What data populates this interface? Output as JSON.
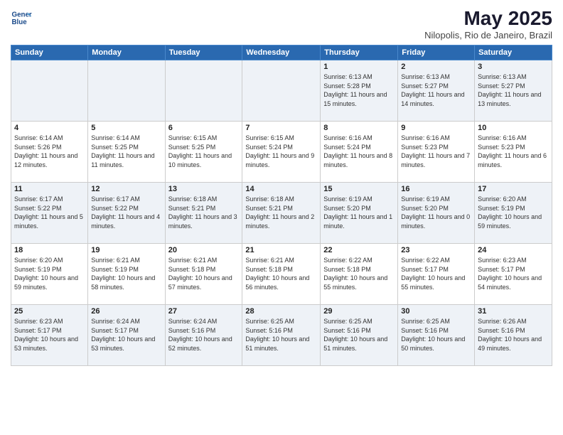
{
  "header": {
    "logo_line1": "General",
    "logo_line2": "Blue",
    "title": "May 2025",
    "subtitle": "Nilopolis, Rio de Janeiro, Brazil"
  },
  "weekdays": [
    "Sunday",
    "Monday",
    "Tuesday",
    "Wednesday",
    "Thursday",
    "Friday",
    "Saturday"
  ],
  "weeks": [
    [
      {
        "day": "",
        "info": ""
      },
      {
        "day": "",
        "info": ""
      },
      {
        "day": "",
        "info": ""
      },
      {
        "day": "",
        "info": ""
      },
      {
        "day": "1",
        "info": "Sunrise: 6:13 AM\nSunset: 5:28 PM\nDaylight: 11 hours\nand 15 minutes."
      },
      {
        "day": "2",
        "info": "Sunrise: 6:13 AM\nSunset: 5:27 PM\nDaylight: 11 hours\nand 14 minutes."
      },
      {
        "day": "3",
        "info": "Sunrise: 6:13 AM\nSunset: 5:27 PM\nDaylight: 11 hours\nand 13 minutes."
      }
    ],
    [
      {
        "day": "4",
        "info": "Sunrise: 6:14 AM\nSunset: 5:26 PM\nDaylight: 11 hours\nand 12 minutes."
      },
      {
        "day": "5",
        "info": "Sunrise: 6:14 AM\nSunset: 5:25 PM\nDaylight: 11 hours\nand 11 minutes."
      },
      {
        "day": "6",
        "info": "Sunrise: 6:15 AM\nSunset: 5:25 PM\nDaylight: 11 hours\nand 10 minutes."
      },
      {
        "day": "7",
        "info": "Sunrise: 6:15 AM\nSunset: 5:24 PM\nDaylight: 11 hours\nand 9 minutes."
      },
      {
        "day": "8",
        "info": "Sunrise: 6:16 AM\nSunset: 5:24 PM\nDaylight: 11 hours\nand 8 minutes."
      },
      {
        "day": "9",
        "info": "Sunrise: 6:16 AM\nSunset: 5:23 PM\nDaylight: 11 hours\nand 7 minutes."
      },
      {
        "day": "10",
        "info": "Sunrise: 6:16 AM\nSunset: 5:23 PM\nDaylight: 11 hours\nand 6 minutes."
      }
    ],
    [
      {
        "day": "11",
        "info": "Sunrise: 6:17 AM\nSunset: 5:22 PM\nDaylight: 11 hours\nand 5 minutes."
      },
      {
        "day": "12",
        "info": "Sunrise: 6:17 AM\nSunset: 5:22 PM\nDaylight: 11 hours\nand 4 minutes."
      },
      {
        "day": "13",
        "info": "Sunrise: 6:18 AM\nSunset: 5:21 PM\nDaylight: 11 hours\nand 3 minutes."
      },
      {
        "day": "14",
        "info": "Sunrise: 6:18 AM\nSunset: 5:21 PM\nDaylight: 11 hours\nand 2 minutes."
      },
      {
        "day": "15",
        "info": "Sunrise: 6:19 AM\nSunset: 5:20 PM\nDaylight: 11 hours\nand 1 minute."
      },
      {
        "day": "16",
        "info": "Sunrise: 6:19 AM\nSunset: 5:20 PM\nDaylight: 11 hours\nand 0 minutes."
      },
      {
        "day": "17",
        "info": "Sunrise: 6:20 AM\nSunset: 5:19 PM\nDaylight: 10 hours\nand 59 minutes."
      }
    ],
    [
      {
        "day": "18",
        "info": "Sunrise: 6:20 AM\nSunset: 5:19 PM\nDaylight: 10 hours\nand 59 minutes."
      },
      {
        "day": "19",
        "info": "Sunrise: 6:21 AM\nSunset: 5:19 PM\nDaylight: 10 hours\nand 58 minutes."
      },
      {
        "day": "20",
        "info": "Sunrise: 6:21 AM\nSunset: 5:18 PM\nDaylight: 10 hours\nand 57 minutes."
      },
      {
        "day": "21",
        "info": "Sunrise: 6:21 AM\nSunset: 5:18 PM\nDaylight: 10 hours\nand 56 minutes."
      },
      {
        "day": "22",
        "info": "Sunrise: 6:22 AM\nSunset: 5:18 PM\nDaylight: 10 hours\nand 55 minutes."
      },
      {
        "day": "23",
        "info": "Sunrise: 6:22 AM\nSunset: 5:17 PM\nDaylight: 10 hours\nand 55 minutes."
      },
      {
        "day": "24",
        "info": "Sunrise: 6:23 AM\nSunset: 5:17 PM\nDaylight: 10 hours\nand 54 minutes."
      }
    ],
    [
      {
        "day": "25",
        "info": "Sunrise: 6:23 AM\nSunset: 5:17 PM\nDaylight: 10 hours\nand 53 minutes."
      },
      {
        "day": "26",
        "info": "Sunrise: 6:24 AM\nSunset: 5:17 PM\nDaylight: 10 hours\nand 53 minutes."
      },
      {
        "day": "27",
        "info": "Sunrise: 6:24 AM\nSunset: 5:16 PM\nDaylight: 10 hours\nand 52 minutes."
      },
      {
        "day": "28",
        "info": "Sunrise: 6:25 AM\nSunset: 5:16 PM\nDaylight: 10 hours\nand 51 minutes."
      },
      {
        "day": "29",
        "info": "Sunrise: 6:25 AM\nSunset: 5:16 PM\nDaylight: 10 hours\nand 51 minutes."
      },
      {
        "day": "30",
        "info": "Sunrise: 6:25 AM\nSunset: 5:16 PM\nDaylight: 10 hours\nand 50 minutes."
      },
      {
        "day": "31",
        "info": "Sunrise: 6:26 AM\nSunset: 5:16 PM\nDaylight: 10 hours\nand 49 minutes."
      }
    ]
  ]
}
